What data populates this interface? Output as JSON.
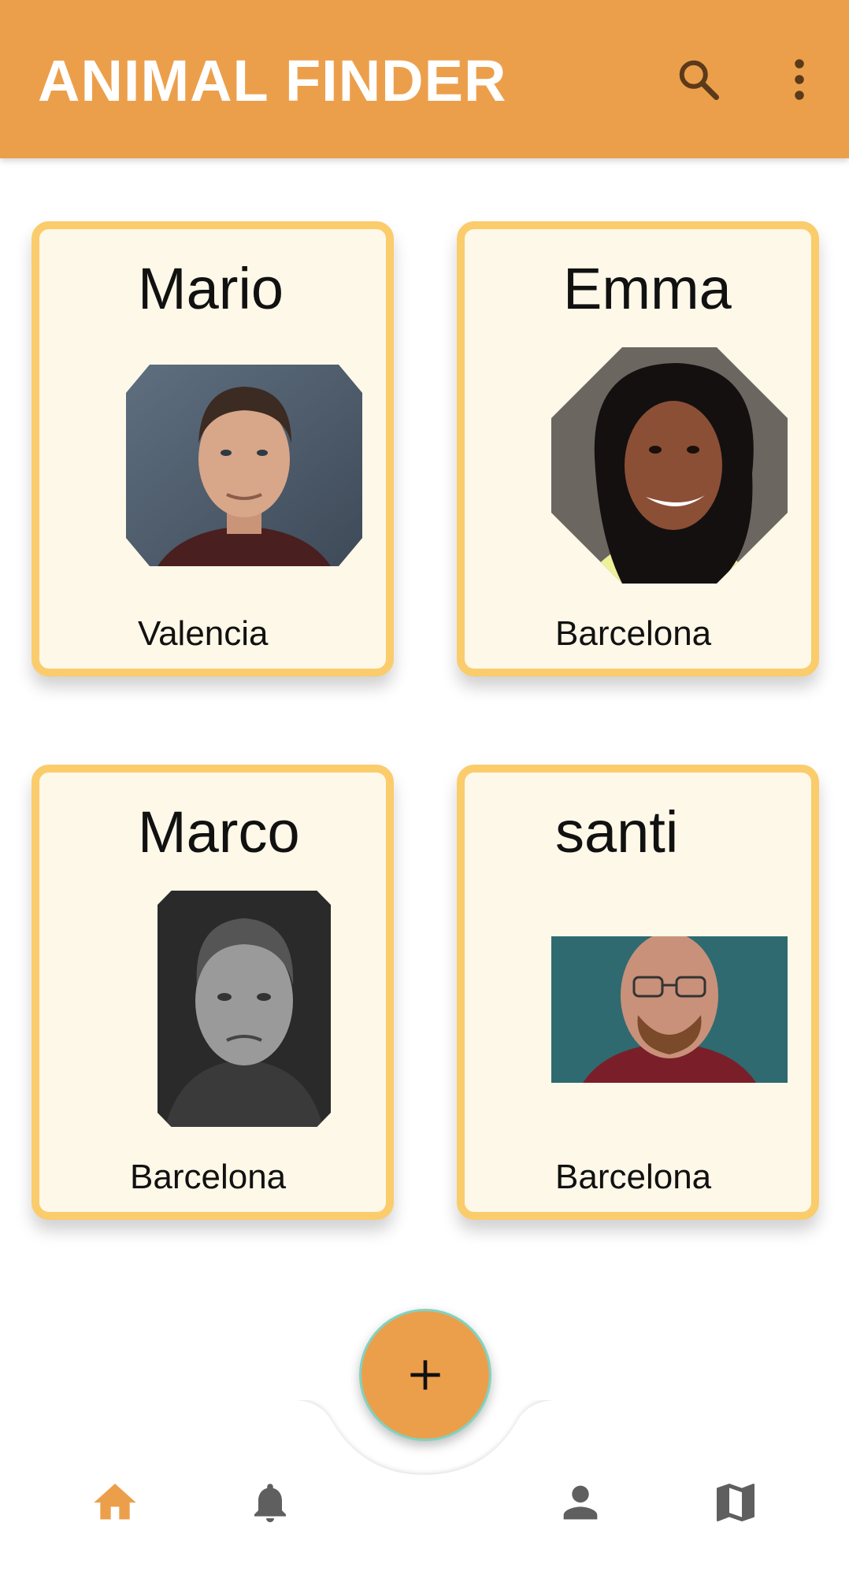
{
  "app_bar": {
    "title": "ANIMAL FINDER",
    "search_icon": "search-icon",
    "more_icon": "more-vert-icon",
    "color": "#ec9f4b"
  },
  "cards": [
    {
      "name": "Mario",
      "city": "Valencia"
    },
    {
      "name": "Emma",
      "city": "Barcelona"
    },
    {
      "name": "Marco",
      "city": "Barcelona"
    },
    {
      "name": "santi",
      "city": "Barcelona"
    }
  ],
  "fab": {
    "label": "+",
    "icon": "add-icon"
  },
  "bottom_nav": {
    "items": [
      {
        "icon": "home-icon",
        "active": true
      },
      {
        "icon": "bell-icon",
        "active": false
      },
      {
        "icon": "person-icon",
        "active": false
      },
      {
        "icon": "map-icon",
        "active": false
      }
    ],
    "active_color": "#ec9f4b",
    "inactive_color": "#5f5f5f"
  },
  "colors": {
    "card_background": "#fdf8e8",
    "card_border": "#fbcc6c",
    "fab_border": "#7fd3c2"
  }
}
